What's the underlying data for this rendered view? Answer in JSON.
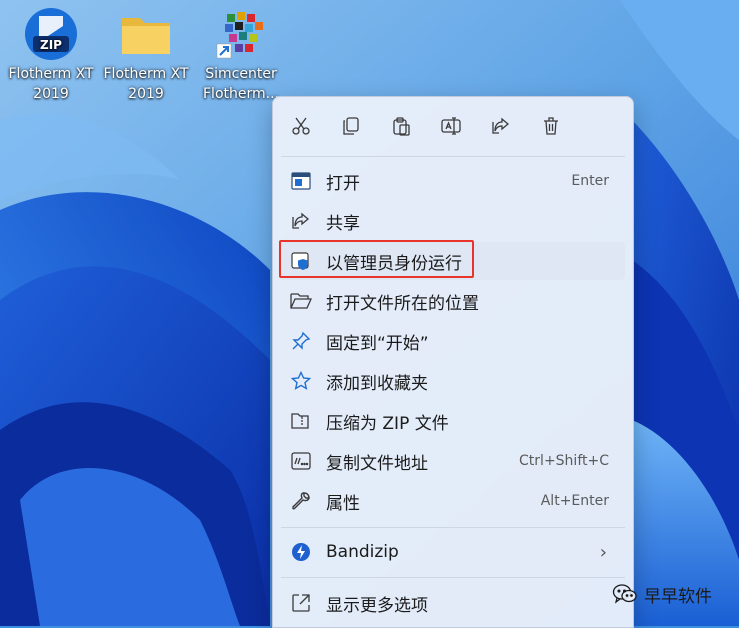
{
  "desktop": {
    "icons": [
      {
        "label_line1": "Flotherm XT",
        "label_line2": "2019",
        "icon": "zip-archive-icon",
        "badge": "ZIP"
      },
      {
        "label_line1": "Flotherm XT",
        "label_line2": "2019",
        "icon": "folder-icon"
      },
      {
        "label_line1": "Simcenter",
        "label_line2": "Flotherm...",
        "icon": "simcenter-app-icon"
      }
    ]
  },
  "context_menu": {
    "toolbar": [
      "cut-icon",
      "copy-icon",
      "paste-icon",
      "rename-icon",
      "share-icon",
      "delete-icon"
    ],
    "items": [
      {
        "label": "打开",
        "shortcut": "Enter",
        "icon": "open-window-icon"
      },
      {
        "label": "共享",
        "shortcut": "",
        "icon": "share-icon"
      },
      {
        "label": "以管理员身份运行",
        "shortcut": "",
        "icon": "admin-shield-icon"
      },
      {
        "label": "打开文件所在的位置",
        "shortcut": "",
        "icon": "folder-open-icon"
      },
      {
        "label": "固定到“开始”",
        "shortcut": "",
        "icon": "pin-icon"
      },
      {
        "label": "添加到收藏夹",
        "shortcut": "",
        "icon": "star-icon"
      },
      {
        "label": "压缩为 ZIP 文件",
        "shortcut": "",
        "icon": "zip-file-icon"
      },
      {
        "label": "复制文件地址",
        "shortcut": "Ctrl+Shift+C",
        "icon": "copy-path-icon"
      },
      {
        "label": "属性",
        "shortcut": "Alt+Enter",
        "icon": "wrench-icon"
      },
      {
        "label": "Bandizip",
        "shortcut": "",
        "icon": "bandizip-icon"
      },
      {
        "label": "显示更多选项",
        "shortcut": "",
        "icon": "more-options-icon"
      }
    ]
  },
  "watermark": {
    "text": "早早软件",
    "icon": "wechat-icon"
  },
  "colors": {
    "highlight_border": "#e8342b",
    "menu_bg": "#e8eefa",
    "accent": "#1f6fd1"
  }
}
